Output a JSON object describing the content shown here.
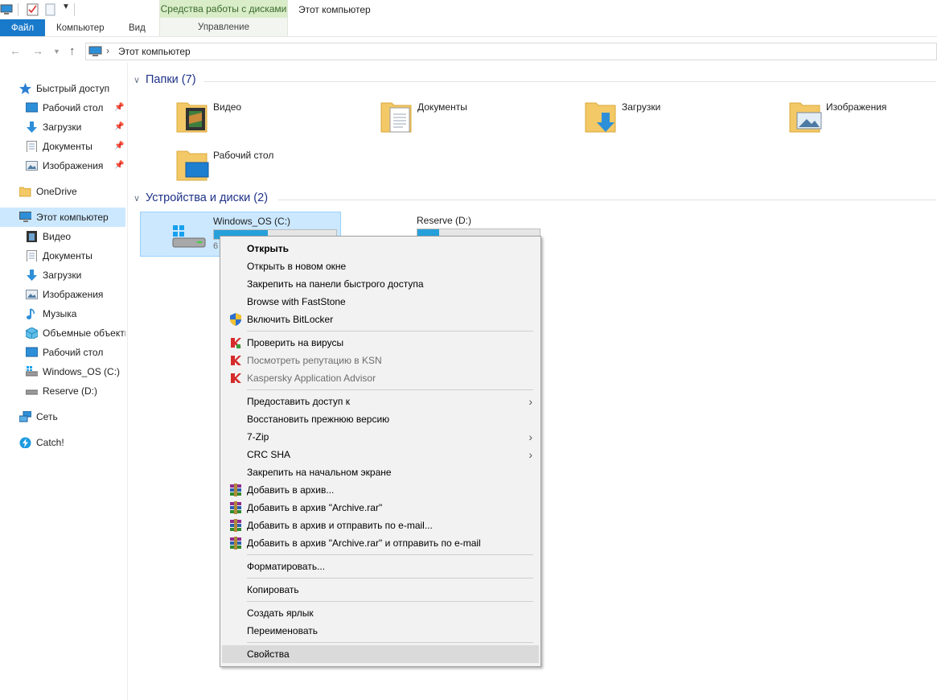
{
  "ribbon": {
    "context_group": "Средства работы с дисками",
    "context_tab": "Управление",
    "window_title": "Этот компьютер",
    "tabs": [
      {
        "label": "Файл"
      },
      {
        "label": "Компьютер"
      },
      {
        "label": "Вид"
      }
    ]
  },
  "address": {
    "path": "Этот компьютер"
  },
  "sidebar": {
    "items": [
      {
        "label": "Быстрый доступ",
        "icon": "star-icon"
      },
      {
        "label": "Рабочий стол",
        "icon": "desktop-icon",
        "pinned": true
      },
      {
        "label": "Загрузки",
        "icon": "download-icon",
        "pinned": true
      },
      {
        "label": "Документы",
        "icon": "documents-icon",
        "pinned": true
      },
      {
        "label": "Изображения",
        "icon": "pictures-icon",
        "pinned": true
      },
      {
        "label": "OneDrive",
        "icon": "folder-icon"
      },
      {
        "label": "Этот компьютер",
        "icon": "computer-icon",
        "selected": true
      },
      {
        "label": "Видео",
        "icon": "video-icon"
      },
      {
        "label": "Документы",
        "icon": "documents-icon"
      },
      {
        "label": "Загрузки",
        "icon": "download-icon"
      },
      {
        "label": "Изображения",
        "icon": "pictures-icon"
      },
      {
        "label": "Музыка",
        "icon": "music-icon"
      },
      {
        "label": "Объемные объекты",
        "icon": "3d-objects-icon"
      },
      {
        "label": "Рабочий стол",
        "icon": "desktop-icon"
      },
      {
        "label": "Windows_OS (C:)",
        "icon": "system-drive-icon"
      },
      {
        "label": "Reserve (D:)",
        "icon": "drive-icon"
      },
      {
        "label": "Сеть",
        "icon": "network-icon"
      },
      {
        "label": "Catch!",
        "icon": "catch-icon"
      }
    ]
  },
  "content": {
    "folders_header": "Папки (7)",
    "folders": [
      {
        "name": "Видео",
        "icon": "video-folder-icon"
      },
      {
        "name": "Документы",
        "icon": "documents-folder-icon"
      },
      {
        "name": "Загрузки",
        "icon": "downloads-folder-icon"
      },
      {
        "name": "Изображения",
        "icon": "pictures-folder-icon"
      },
      {
        "name": "Рабочий стол",
        "icon": "desktop-folder-icon"
      }
    ],
    "devices_header": "Устройства и диски (2)",
    "drives": [
      {
        "name": "Windows_OS (C:)",
        "used_fraction": 0.44,
        "free_text": "6",
        "selected": true
      },
      {
        "name": "Reserve (D:)",
        "used_fraction": 0.18,
        "free_text": "",
        "selected": false
      }
    ]
  },
  "context_menu": {
    "items": [
      {
        "label": "Открыть",
        "bold": true
      },
      {
        "label": "Открыть в новом окне"
      },
      {
        "label": "Закрепить на панели быстрого доступа"
      },
      {
        "label": "Browse with FastStone"
      },
      {
        "label": "Включить BitLocker",
        "icon": "shield-icon"
      },
      {
        "label": "Проверить на вирусы",
        "icon": "kaspersky-icon"
      },
      {
        "label": "Посмотреть репутацию в KSN",
        "icon": "kaspersky-icon",
        "disabled": true
      },
      {
        "label": "Kaspersky Application Advisor",
        "icon": "kaspersky-icon",
        "disabled": true
      },
      {
        "label": "Предоставить доступ к",
        "submenu": true
      },
      {
        "label": "Восстановить прежнюю версию"
      },
      {
        "label": "7-Zip",
        "submenu": true
      },
      {
        "label": "CRC SHA",
        "submenu": true
      },
      {
        "label": "Закрепить на начальном экране"
      },
      {
        "label": "Добавить в архив...",
        "icon": "winrar-icon"
      },
      {
        "label": "Добавить в архив \"Archive.rar\"",
        "icon": "winrar-icon"
      },
      {
        "label": "Добавить в архив и отправить по e-mail...",
        "icon": "winrar-icon"
      },
      {
        "label": "Добавить в архив \"Archive.rar\" и отправить по e-mail",
        "icon": "winrar-icon"
      },
      {
        "label": "Форматировать..."
      },
      {
        "label": "Копировать"
      },
      {
        "label": "Создать ярлык"
      },
      {
        "label": "Переименовать"
      },
      {
        "label": "Свойства",
        "highlighted": true
      }
    ]
  },
  "colors": {
    "accent": "#1979ca",
    "selection": "#cce8ff",
    "header_text": "#1e3287",
    "drive_bar": "#26a0da",
    "context_tools": "#d9edc9"
  }
}
